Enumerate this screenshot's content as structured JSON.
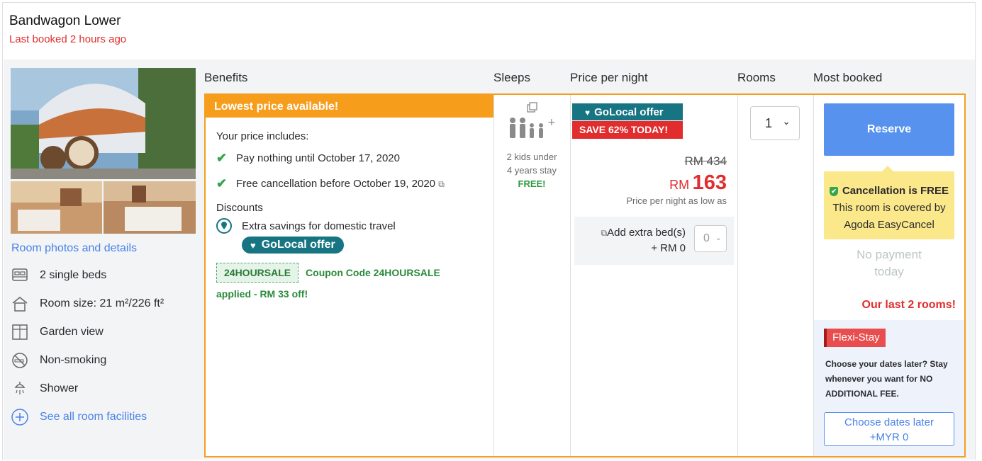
{
  "room": {
    "title": "Bandwagon Lower",
    "last_booked": "Last booked 2 hours ago"
  },
  "left": {
    "photos_link": "Room photos and details",
    "facilities": [
      {
        "icon": "bed-icon",
        "label": "2 single beds"
      },
      {
        "icon": "house-icon",
        "label": "Room size: 21 m²/226 ft²"
      },
      {
        "icon": "window-icon",
        "label": "Garden view"
      },
      {
        "icon": "no-smoking-icon",
        "label": "Non-smoking"
      },
      {
        "icon": "shower-icon",
        "label": "Shower"
      }
    ],
    "see_all": "See all room facilities"
  },
  "headers": {
    "benefits": "Benefits",
    "sleeps": "Sleeps",
    "price": "Price per night",
    "rooms": "Rooms",
    "most_booked": "Most booked"
  },
  "benefits": {
    "banner": "Lowest price available!",
    "price_includes": "Your price includes:",
    "items": [
      "Pay nothing until October 17, 2020",
      "Free cancellation before October 19, 2020"
    ],
    "discounts_title": "Discounts",
    "discount_item": "Extra savings for domestic travel",
    "golocal_pill": "GoLocal offer",
    "coupon_tag": "24HOURSALE",
    "coupon_text": "Coupon Code 24HOURSALE",
    "coupon_applied": "applied - RM 33 off!"
  },
  "sleeps": {
    "line1": "2 kids under",
    "line2": "4 years stay",
    "free": "FREE!"
  },
  "price": {
    "golocal_badge": "GoLocal offer",
    "save_badge": "SAVE 62% TODAY!",
    "old": "RM 434",
    "currency": "RM",
    "amount": "163",
    "note": "Price per night as low as",
    "extra_bed_label": "Add extra bed(s)",
    "extra_bed_price": "+ RM 0",
    "extra_bed_value": "0"
  },
  "rooms": {
    "selected": "1"
  },
  "booking": {
    "reserve": "Reserve",
    "cancel_title": "Cancellation is FREE",
    "cancel_line1": "This room is covered by",
    "cancel_line2": "Agoda EasyCancel",
    "no_payment_1": "No payment",
    "no_payment_2": "today",
    "last_rooms": "Our last 2 rooms!",
    "flexi_tag": "Flexi-Stay",
    "flexi_text": "Choose your dates later? Stay whenever you want for NO ADDITIONAL FEE.",
    "choose_1": "Choose dates later",
    "choose_2": "+MYR 0"
  },
  "colors": {
    "accent_orange": "#f59f21",
    "golocal_teal": "#167483",
    "red": "#e12d2d",
    "reserve_blue": "#5892ef",
    "cancel_yellow": "#fbe88a"
  }
}
